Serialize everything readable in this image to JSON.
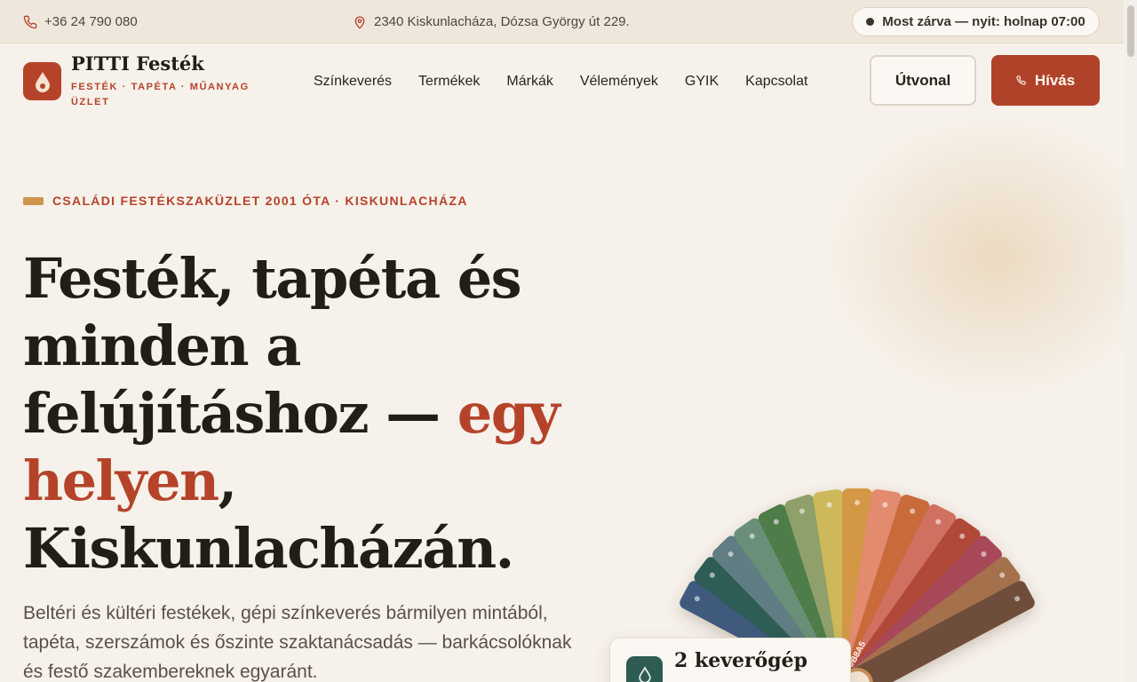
{
  "topbar": {
    "phone": "+36 24 790 080",
    "address": "2340 Kiskunlacháza, Dózsa György út 229.",
    "status": "Most zárva — nyit: holnap 07:00"
  },
  "brand": {
    "name": "PITTI Festék",
    "tagline": "FESTÉK · TAPÉTA · MŰANYAG ÜZLET"
  },
  "nav": [
    "Színkeverés",
    "Termékek",
    "Márkák",
    "Vélemények",
    "GYIK",
    "Kapcsolat"
  ],
  "actions": {
    "route": "Útvonal",
    "call": "Hívás"
  },
  "hero": {
    "eyebrow": "CSALÁDI FESTÉKSZAKÜZLET 2001 ÓTA · KISKUNLACHÁZA",
    "headline_part1": "Festék, tapéta és minden a felújításhoz — ",
    "headline_accent": "egy helyen",
    "headline_part2": ", Kiskunlacházán.",
    "lede": "Beltéri és kültéri festékek, gépi színkeverés bármilyen mintából, tapéta, szerszámok és őszinte szaktanácsadás — barkácsolóknak és festő szakembereknek egyaránt."
  },
  "swatch_label": "#B8A5",
  "card": {
    "title": "2 keverőgép"
  },
  "colors": {
    "accent": "#b5432a",
    "eyebrow_bar": "#cf944b",
    "background": "#f6f1ea",
    "swatches": [
      "#3f5a7d",
      "#2e5b57",
      "#5e7d82",
      "#6b8f78",
      "#4f7d4a",
      "#8fa06a",
      "#cdb85a",
      "#d39745",
      "#e28b6e",
      "#c96a3a",
      "#d07060",
      "#b14a38",
      "#a8485a",
      "#a5714e",
      "#6e4e3a"
    ]
  },
  "icons": {
    "phone": "phone-icon",
    "address": "map-pin-icon",
    "logo": "paint-drop-icon",
    "call": "phone-icon",
    "card": "paint-drop-icon"
  }
}
